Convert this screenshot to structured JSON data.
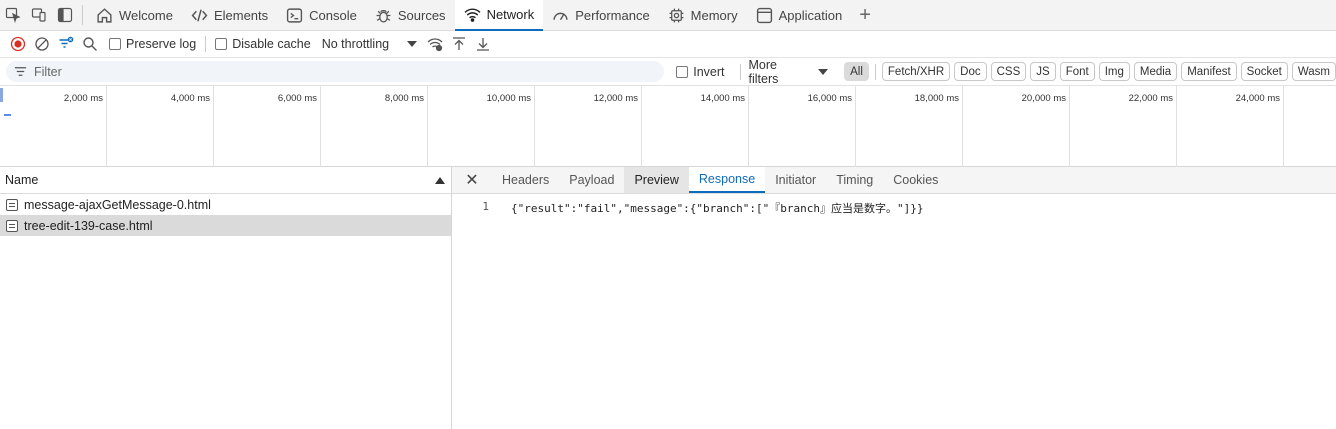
{
  "tabs": [
    {
      "label": "Welcome",
      "icon": "home-icon"
    },
    {
      "label": "Elements",
      "icon": "code-icon"
    },
    {
      "label": "Console",
      "icon": "console-icon"
    },
    {
      "label": "Sources",
      "icon": "bug-icon"
    },
    {
      "label": "Network",
      "icon": "wifi-icon",
      "active": true
    },
    {
      "label": "Performance",
      "icon": "gauge-icon"
    },
    {
      "label": "Memory",
      "icon": "chip-icon"
    },
    {
      "label": "Application",
      "icon": "window-icon"
    }
  ],
  "toolbar": {
    "preserve_log": "Preserve log",
    "disable_cache": "Disable cache",
    "throttling": "No throttling"
  },
  "filterbar": {
    "placeholder": "Filter",
    "invert": "Invert",
    "more_filters": "More filters",
    "types": [
      "All",
      "Fetch/XHR",
      "Doc",
      "CSS",
      "JS",
      "Font",
      "Img",
      "Media",
      "Manifest",
      "Socket",
      "Wasm"
    ]
  },
  "timeline": {
    "ticks": [
      "2,000 ms",
      "4,000 ms",
      "6,000 ms",
      "8,000 ms",
      "10,000 ms",
      "12,000 ms",
      "14,000 ms",
      "16,000 ms",
      "18,000 ms",
      "20,000 ms",
      "22,000 ms",
      "24,000 ms"
    ]
  },
  "requests": {
    "column_name": "Name",
    "items": [
      {
        "name": "message-ajaxGetMessage-0.html",
        "selected": false
      },
      {
        "name": "tree-edit-139-case.html",
        "selected": true
      }
    ]
  },
  "detail": {
    "tabs": [
      "Headers",
      "Payload",
      "Preview",
      "Response",
      "Initiator",
      "Timing",
      "Cookies"
    ],
    "active_tab": "Response",
    "line_number": "1",
    "response_body": "{\"result\":\"fail\",\"message\":{\"branch\":[\"『branch』应当是数字。\"]}}"
  }
}
